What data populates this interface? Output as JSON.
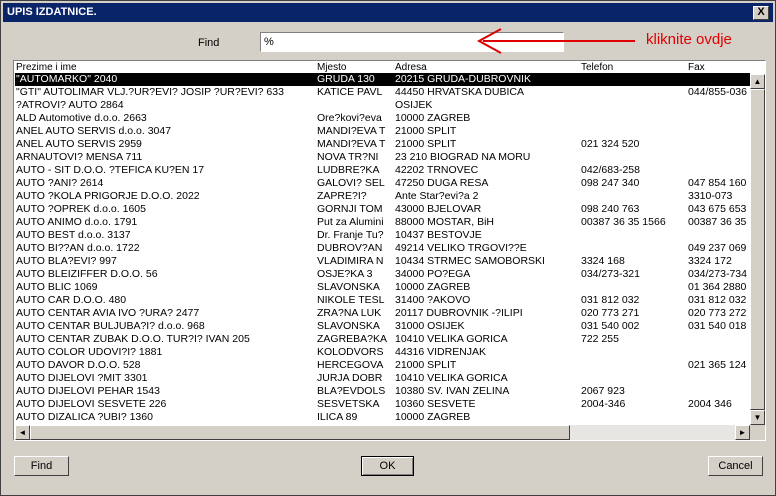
{
  "window": {
    "title": "UPIS IZDATNICE.",
    "close_glyph": "X"
  },
  "search": {
    "label": "Find",
    "value": "%"
  },
  "annotation": {
    "text": "kliknite ovdje",
    "color": "#e00000"
  },
  "columns": [
    "Prezime i ime",
    "Mjesto",
    "Adresa",
    "Telefon",
    "Fax"
  ],
  "rows": [
    [
      "\"AUTOMARKO\"  2040",
      "GRUDA 130",
      "20215 GRUDA-DUBROVNIK",
      "",
      ""
    ],
    [
      "\"GTI\" AUTOLIMAR VLJ.?UR?EVI? JOSIP ?UR?EVI? 633",
      "KATICE PAVL",
      "44450 HRVATSKA DUBICA",
      "",
      "044/855-036"
    ],
    [
      "?ATROVI? AUTO  2864",
      "",
      "OSIJEK",
      "",
      ""
    ],
    [
      "ALD Automotive d.o.o.  2663",
      "Ore?kovi?eva",
      "10000 ZAGREB",
      "",
      ""
    ],
    [
      "ANEL  AUTO SERVIS d.o.o.  3047",
      "MANDI?EVA T",
      "21000 SPLIT",
      "",
      ""
    ],
    [
      "ANEL AUTO SERVIS  2959",
      "MANDI?EVA T",
      "21000 SPLIT",
      "021 324 520",
      ""
    ],
    [
      "ARNAUTOVI? MENSA  711",
      "NOVA TR?NI",
      "23 210 BIOGRAD NA MORU",
      "",
      ""
    ],
    [
      "AUTO - SIT  D.O.O.          ?TEFICA KU?EN 17",
      "LUDBRE?KA",
      "42202 TRNOVEC",
      "042/683-258",
      ""
    ],
    [
      "AUTO ?ANI?  2614",
      "GALOVI? SEL",
      "47250 DUGA RESA",
      "098 247 340",
      "047 854 160"
    ],
    [
      "AUTO ?KOLA PRIGORJE D.O.O.  2022",
      "ZAPRE?I?",
      "Ante Star?evi?a 2",
      "",
      "3310-073"
    ],
    [
      "AUTO ?OPREK d.o.o.  1605",
      "GORNJI TOM",
      "43000 BJELOVAR",
      "098 240 763",
      "043 675 653"
    ],
    [
      "AUTO ANIMO d.o.o.  1791",
      "Put za Alumini",
      "88000 MOSTAR, BiH",
      "00387 36 35 1566",
      "00387 36 35"
    ],
    [
      "AUTO BEST d.o.o.  3137",
      "Dr. Franje Tu?",
      "10437 BESTOVJE",
      "",
      ""
    ],
    [
      "AUTO BI??AN d.o.o.  1722",
      "DUBROV?AN",
      "49214 VELIKO TRGOVI??E",
      "",
      "049 237 069"
    ],
    [
      "AUTO BLA?EVI?  997",
      "VLADIMIRA N",
      "10434 STRMEC SAMOBORSKI",
      "3324 168",
      "3324 172"
    ],
    [
      "AUTO BLEIZIFFER  D.O.O.          56",
      "OSJE?KA 3",
      "34000 PO?EGA",
      "034/273-321",
      "034/273-734"
    ],
    [
      "AUTO BLIC  1069",
      "SLAVONSKA",
      "10000 ZAGREB",
      "",
      "01 364 2880"
    ],
    [
      "AUTO CAR D.O.O.  480",
      "NIKOLE TESL",
      "31400 ?AKOVO",
      "031 812 032",
      "031 812 032"
    ],
    [
      "AUTO CENTAR AVIA IVO ?URA? 2477",
      "ZRA?NA LUK",
      "20117 DUBROVNIK -?ILIPI",
      "020 773 271",
      "020 773 272"
    ],
    [
      "AUTO CENTAR BULJUBA?I? d.o.o.  968",
      "SLAVONSKA",
      "31000 OSIJEK",
      "031 540 002",
      "031 540 018"
    ],
    [
      "AUTO CENTAR ZUBAK D.O.O.        TUR?I? IVAN 205",
      "ZAGREBA?KA",
      "10410 VELIKA GORICA",
      "722 255",
      ""
    ],
    [
      "AUTO COLOR UDOVI?I?  1881",
      "KOLODVORS",
      "44316 VIDRENJAK",
      "",
      ""
    ],
    [
      "AUTO DAVOR D.O.O.  528",
      "HERCEGOVA",
      "21000 SPLIT",
      "",
      "021 365 124"
    ],
    [
      "AUTO DIJELOVI ?MIT  3301",
      "JURJA DOBR",
      "10410 VELIKA GORICA",
      "",
      ""
    ],
    [
      "AUTO DIJELOVI PEHAR  1543",
      "BLA?EVDOLS",
      "10380 SV. IVAN ZELINA",
      "2067 923",
      ""
    ],
    [
      "AUTO DIJELOVI SESVETE          226",
      "SESVETSKA",
      "10360 SESVETE",
      "2004-346",
      "2004 346"
    ],
    [
      "AUTO DIZALICA ?UBI?  1360",
      "ILICA 89",
      "10000 ZAGREB",
      "",
      ""
    ]
  ],
  "scroll": {
    "up": "▲",
    "down": "▼",
    "left": "◄",
    "right": "►"
  },
  "buttons": {
    "find": "Find",
    "ok": "OK",
    "cancel": "Cancel"
  }
}
